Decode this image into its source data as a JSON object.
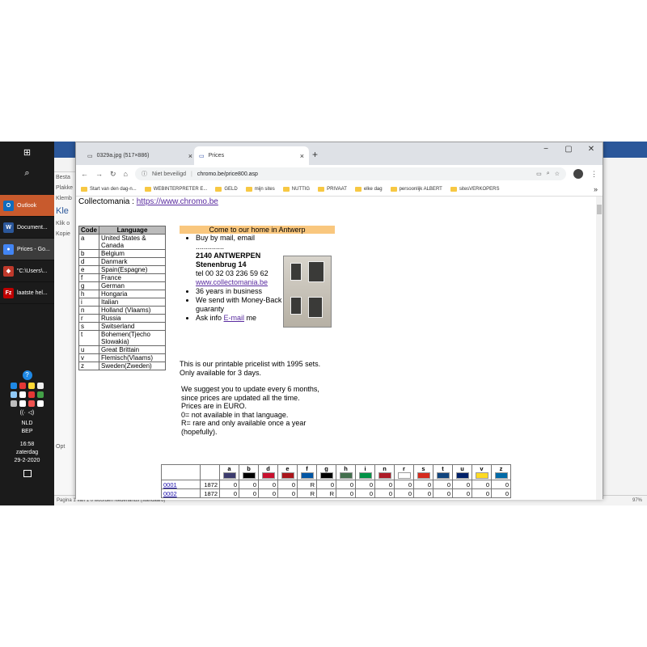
{
  "taskbar": {
    "apps": [
      {
        "label": "Outlook",
        "icon": "outlook-icon",
        "color": "#0f6cbd",
        "letter": "O"
      },
      {
        "label": "Document...",
        "icon": "word-icon",
        "color": "#2b579a",
        "letter": "W"
      },
      {
        "label": "Prices - Go...",
        "icon": "chrome-icon",
        "color": "#4285f4",
        "letter": "●"
      },
      {
        "label": "\"C:\\Users\\...",
        "icon": "app-icon",
        "color": "#c0392b",
        "letter": "◆"
      },
      {
        "label": "laatste hel...",
        "icon": "filezilla-icon",
        "color": "#bf0000",
        "letter": "Fz"
      }
    ],
    "language": "NLD",
    "keyboard": "BEP",
    "time": "16:58",
    "day": "zaterdag",
    "date": "29-2-2020"
  },
  "word": {
    "side_items": [
      "Besta",
      "Plakke",
      "Klemb",
      "Kle",
      "Klik o",
      "Kopie",
      "Opt"
    ],
    "status": "Pagina 1 van 1     0 woorden     Nederlands (standaard)",
    "zoom": "97%"
  },
  "browser": {
    "tabs": [
      {
        "title": "0329a.jpg (517×886)",
        "active": false
      },
      {
        "title": "Prices",
        "active": true
      }
    ],
    "security": "Niet beveiligd",
    "url": "chromo.be/price800.asp",
    "bookmarks": [
      "Start van den dag-n...",
      "WEBINTERPRETER E...",
      "GELD",
      "mijn sites",
      "NUTTIG",
      "PRIVAAT",
      "elke dag",
      "persoonlijk ALBERT",
      "sitesVERKOPERS"
    ]
  },
  "page": {
    "site_prefix": "Collectomania : ",
    "site_link": "https://www.chromo.be",
    "lang_headers": [
      "Code",
      "Language"
    ],
    "languages": [
      [
        "a",
        "United States & Canada"
      ],
      [
        "b",
        "Belgium"
      ],
      [
        "d",
        "Danmark"
      ],
      [
        "e",
        "Spain(Espagne)"
      ],
      [
        "f",
        "France"
      ],
      [
        "g",
        "German"
      ],
      [
        "h",
        "Hongaria"
      ],
      [
        "i",
        "Italian"
      ],
      [
        "n",
        "Holland (Vlaams)"
      ],
      [
        "r",
        "Russia"
      ],
      [
        "s",
        "Switserland"
      ],
      [
        "t",
        "Bohemen(Tjecho Slowakia)"
      ],
      [
        "u",
        "Great Brittain"
      ],
      [
        "v",
        "Flemisch(Vlaams)"
      ],
      [
        "z",
        "Sweden(Zweden)"
      ]
    ],
    "promo_title": "Come to our home in Antwerp",
    "promo_mail": "Buy by mail, email",
    "promo_dots": "..............",
    "address1": "2140 ANTWERPEN",
    "address2": "Stenenbrug 14",
    "tel": "tel 00 32 03 236 59 62",
    "site2": "www.collectomania.be",
    "bullets": [
      "36 years in business",
      "We send with Money-Back guaranty"
    ],
    "ask_prefix": "Ask info ",
    "ask_link": "E-mail",
    "ask_suffix": " me",
    "info1": "This is our printable pricelist with 1995 sets.",
    "info2": "Only available for 3 days.",
    "info3": "We suggest you to update every 6 months, since prices are updated all the time.",
    "info4": "Prices are in EURO.",
    "info5": "0= not available in that language.",
    "info6": "R= rare and only available once a year (hopefully).",
    "price_cols": [
      "a",
      "b",
      "d",
      "e",
      "f",
      "g",
      "h",
      "i",
      "n",
      "r",
      "s",
      "t",
      "u",
      "v",
      "z"
    ],
    "flag_colors": [
      "#3c3b6e",
      "#000000",
      "#c8102e",
      "#aa151b",
      "#0055a4",
      "#000000",
      "#436f4d",
      "#009246",
      "#ae1c28",
      "#ffffff",
      "#d52b1e",
      "#11457e",
      "#012169",
      "#fdda24",
      "#006aa7"
    ],
    "price_rows": [
      {
        "code": "0001",
        "year": "1872",
        "vals": [
          "0",
          "0",
          "0",
          "0",
          "R",
          "0",
          "0",
          "0",
          "0",
          "0",
          "0",
          "0",
          "0",
          "0",
          "0"
        ]
      },
      {
        "code": "0002",
        "year": "1872",
        "vals": [
          "0",
          "0",
          "0",
          "0",
          "R",
          "R",
          "0",
          "0",
          "0",
          "0",
          "0",
          "0",
          "0",
          "0",
          "0"
        ]
      }
    ]
  }
}
